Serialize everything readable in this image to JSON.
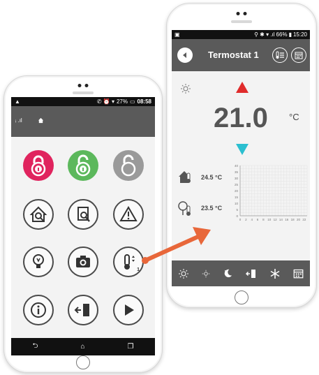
{
  "left_phone": {
    "status": {
      "signal": "ᵢ.ıl",
      "battery_pct": "27%",
      "time": "08:58"
    },
    "appbar": {
      "indicators": "ᵢ .ıl"
    },
    "buttons": [
      {
        "name": "lock-red",
        "icon": "padlock-closed-icon",
        "color": "#e0245e"
      },
      {
        "name": "lock-green",
        "icon": "padlock-open-icon",
        "color": "#5cb85c"
      },
      {
        "name": "lock-grey",
        "icon": "padlock-open-icon",
        "color": "#9a9a9a"
      },
      {
        "name": "home-search",
        "icon": "house-search-icon"
      },
      {
        "name": "document-search",
        "icon": "document-search-icon"
      },
      {
        "name": "warning",
        "icon": "warning-icon"
      },
      {
        "name": "light-bulb",
        "icon": "light-bulb-icon"
      },
      {
        "name": "camera",
        "icon": "camera-icon"
      },
      {
        "name": "thermostat",
        "icon": "thermometer-icon",
        "badge": "1"
      },
      {
        "name": "info",
        "icon": "info-icon"
      },
      {
        "name": "exit",
        "icon": "exit-door-icon"
      },
      {
        "name": "play",
        "icon": "play-icon"
      }
    ]
  },
  "right_phone": {
    "status": {
      "battery_pct": "66%",
      "time": "15:20"
    },
    "title": "Termostat 1",
    "setpoint": "21.0",
    "unit": "°C",
    "temp_inside": "24.5 °C",
    "temp_outside": "23.5 °C",
    "chart_data": {
      "type": "line",
      "x_ticks": [
        "0",
        "2",
        "4",
        "6",
        "8",
        "10",
        "12",
        "14",
        "16",
        "18",
        "20",
        "22"
      ],
      "y_ticks": [
        "0",
        "5",
        "10",
        "15",
        "20",
        "25",
        "30",
        "35",
        "40"
      ],
      "xlim": [
        0,
        23
      ],
      "ylim": [
        0,
        40
      ],
      "series": [],
      "grid": true
    },
    "modes": [
      "sun-icon",
      "sun-small-icon",
      "moon-icon",
      "exit-door-icon",
      "snowflake-icon",
      "calendar-icon"
    ],
    "colors": {
      "up": "#e02b2b",
      "down": "#2bbfd0",
      "bar": "#5a5a5a"
    }
  },
  "arrow_color": "#e8673a"
}
